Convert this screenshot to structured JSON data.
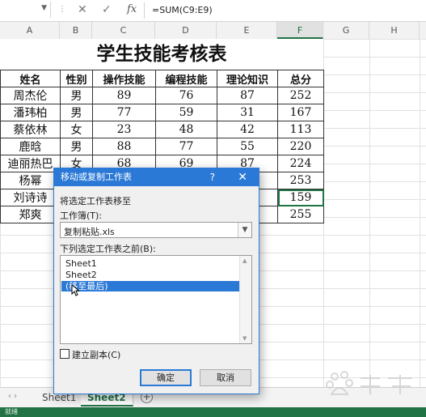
{
  "formula_bar": {
    "cancel_glyph": "✕",
    "enter_glyph": "✓",
    "fx_label": "fx",
    "formula": "=SUM(C9:E9)"
  },
  "columns": [
    "A",
    "B",
    "C",
    "D",
    "E",
    "F",
    "G",
    "H"
  ],
  "sheet": {
    "title": "学生技能考核表",
    "headers": [
      "姓名",
      "性别",
      "操作技能",
      "编程技能",
      "理论知识",
      "总分"
    ],
    "rows": [
      [
        "周杰伦",
        "男",
        "89",
        "76",
        "87",
        "252"
      ],
      [
        "潘玮柏",
        "男",
        "77",
        "59",
        "31",
        "167"
      ],
      [
        "蔡依林",
        "女",
        "23",
        "48",
        "42",
        "113"
      ],
      [
        "鹿晗",
        "男",
        "88",
        "77",
        "55",
        "220"
      ],
      [
        "迪丽热巴",
        "女",
        "68",
        "69",
        "87",
        "224"
      ],
      [
        "杨幂",
        "",
        "",
        "",
        "",
        "253"
      ],
      [
        "刘诗诗",
        "",
        "",
        "",
        "",
        "159"
      ],
      [
        "郑爽",
        "",
        "",
        "",
        "",
        "255"
      ]
    ]
  },
  "dialog": {
    "title": "移动或复制工作表",
    "help": "?",
    "close": "✕",
    "move_label": "将选定工作表移至",
    "workbook_label": "工作簿(T):",
    "workbook_value": "复制粘贴.xls",
    "before_label": "下列选定工作表之前(B):",
    "list_items": [
      "Sheet1",
      "Sheet2",
      "(移至最后)"
    ],
    "selected_index": 2,
    "copy_checkbox_label": "建立副本(C)",
    "ok_label": "确定",
    "cancel_label": "取消"
  },
  "tabs": {
    "nav_glyph": "‹ ›",
    "items": [
      "Sheet1",
      "Sheet2"
    ],
    "active": "Sheet2",
    "add_glyph": "+"
  },
  "status": {
    "text": "就绪"
  },
  "colors": {
    "accent": "#217346",
    "dialog_blue": "#2b79d6"
  }
}
